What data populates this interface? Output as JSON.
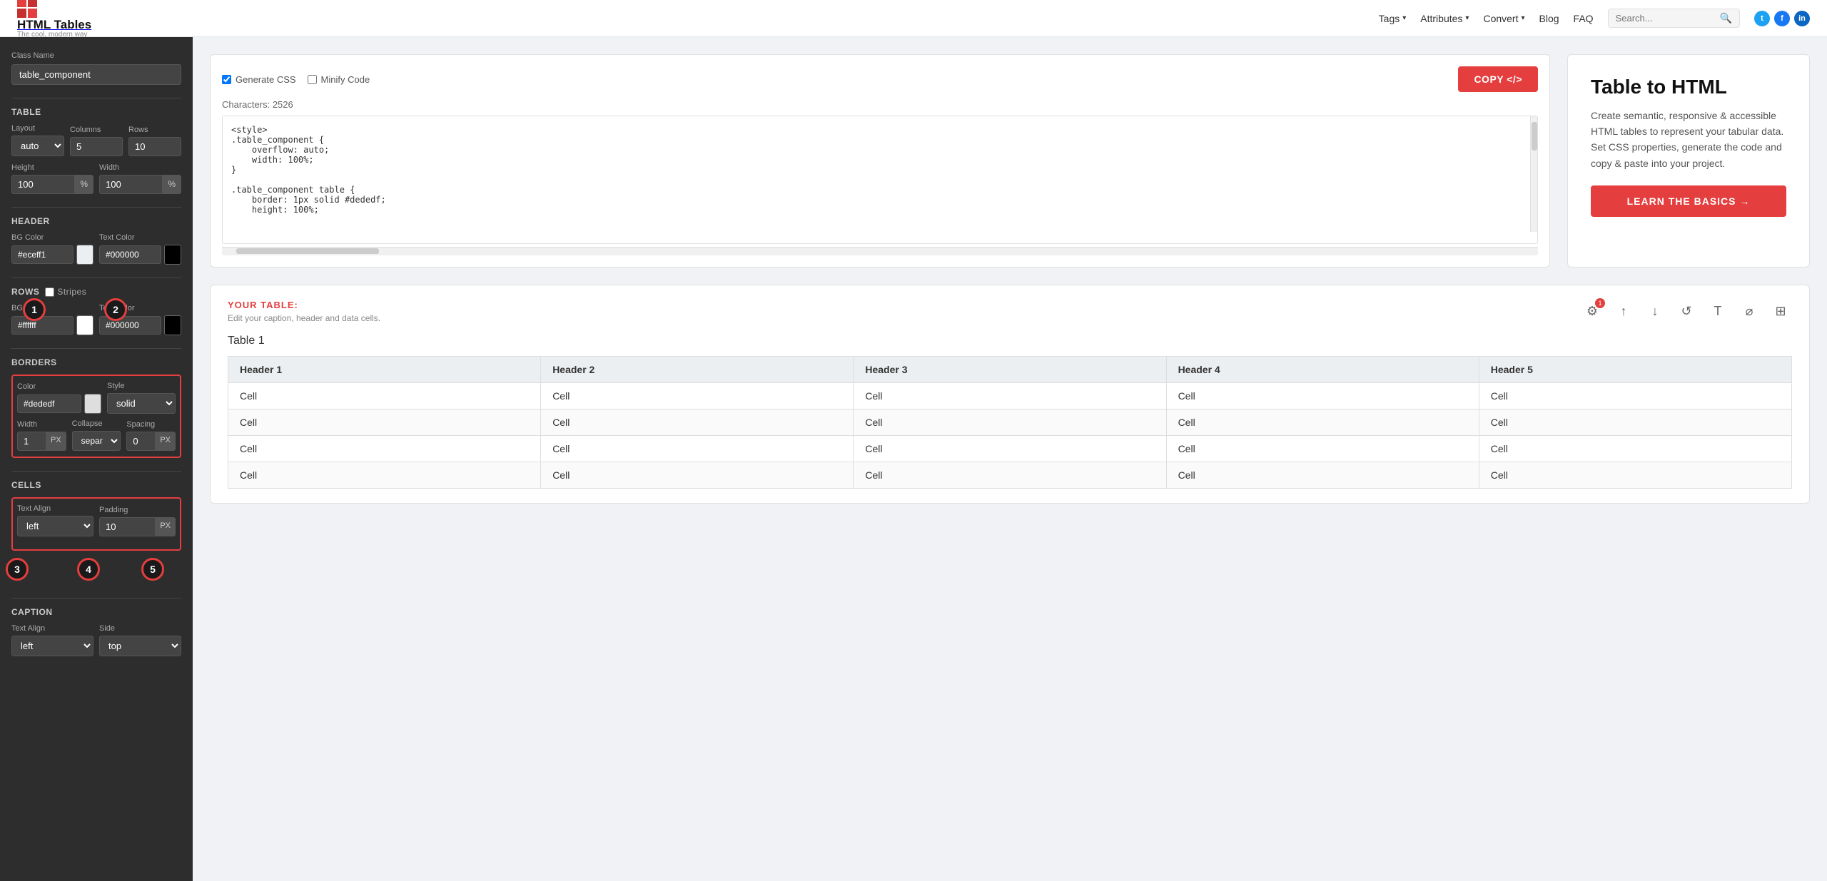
{
  "nav": {
    "logo_text": "HTML Tables",
    "logo_subtitle": "The cool, modern way",
    "links": [
      {
        "label": "Tags",
        "has_dropdown": true
      },
      {
        "label": "Attributes",
        "has_dropdown": true
      },
      {
        "label": "Convert",
        "has_dropdown": true
      },
      {
        "label": "Blog",
        "has_dropdown": false
      },
      {
        "label": "FAQ",
        "has_dropdown": false
      }
    ],
    "search_placeholder": "Search..."
  },
  "sidebar": {
    "class_name_label": "Class Name",
    "class_name_value": "table_component",
    "table_section": "TABLE",
    "layout_label": "Layout",
    "layout_value": "auto",
    "columns_label": "Columns",
    "columns_value": "5",
    "rows_label": "Rows",
    "rows_value": "10",
    "height_label": "Height",
    "height_value": "100",
    "height_unit": "%",
    "width_label": "Width",
    "width_value": "100",
    "width_unit": "%",
    "header_section": "HEADER",
    "header_bg_label": "BG Color",
    "header_bg_value": "#eceff1",
    "header_text_label": "Text Color",
    "header_text_value": "#000000",
    "rows_section": "ROWS",
    "stripes_label": "Stripes",
    "rows_bg_label": "BG Color",
    "rows_bg_value": "#ffffff",
    "rows_text_label": "Text Color",
    "rows_text_value": "#000000",
    "borders_section": "BORDERS",
    "border_color_label": "Color",
    "border_color_value": "#dededf",
    "border_style_label": "Style",
    "border_style_value": "solid",
    "border_width_label": "Width",
    "border_width_value": "1",
    "border_width_unit": "PX",
    "collapse_label": "Collapse",
    "collapse_value": "separate",
    "spacing_label": "Spacing",
    "spacing_value": "0",
    "spacing_unit": "PX",
    "cells_section": "CELLS",
    "text_align_label": "Text Align",
    "text_align_value": "left",
    "padding_label": "Padding",
    "padding_value": "10",
    "padding_unit": "PX",
    "caption_section": "CAPTION",
    "caption_text_align_label": "Text Align",
    "caption_text_align_value": "left",
    "caption_side_label": "Side",
    "caption_side_value": "top",
    "annotation_1": "1",
    "annotation_2": "2",
    "annotation_3": "3",
    "annotation_4": "4",
    "annotation_5": "5"
  },
  "code_panel": {
    "generate_css_label": "Generate CSS",
    "minify_label": "Minify Code",
    "copy_label": "COPY </>",
    "chars_label": "Characters:",
    "chars_value": "2526",
    "code_content": "<style>\n.table_component {\n    overflow: auto;\n    width: 100%;\n}\n\n.table_component table {\n    border: 1px solid #dededf;\n    height: 100%;"
  },
  "info_card": {
    "title": "Table to HTML",
    "description": "Create semantic, responsive & accessible HTML tables to represent your tabular data. Set CSS properties, generate the code and copy & paste into your project.",
    "learn_btn": "LEARN THE BASICS →"
  },
  "table_area": {
    "your_table_label": "YOUR TABLE:",
    "subtitle": "Edit your caption, header and data cells.",
    "table_name": "Table 1",
    "headers": [
      "Header 1",
      "Header 2",
      "Header 3",
      "Header 4",
      "Header 5"
    ],
    "rows": [
      [
        "Cell",
        "Cell",
        "Cell",
        "Cell",
        "Cell"
      ],
      [
        "Cell",
        "Cell",
        "Cell",
        "Cell",
        "Cell"
      ],
      [
        "Cell",
        "Cell",
        "Cell",
        "Cell",
        "Cell"
      ],
      [
        "Cell",
        "Cell",
        "Cell",
        "Cell",
        "Cell"
      ]
    ]
  }
}
